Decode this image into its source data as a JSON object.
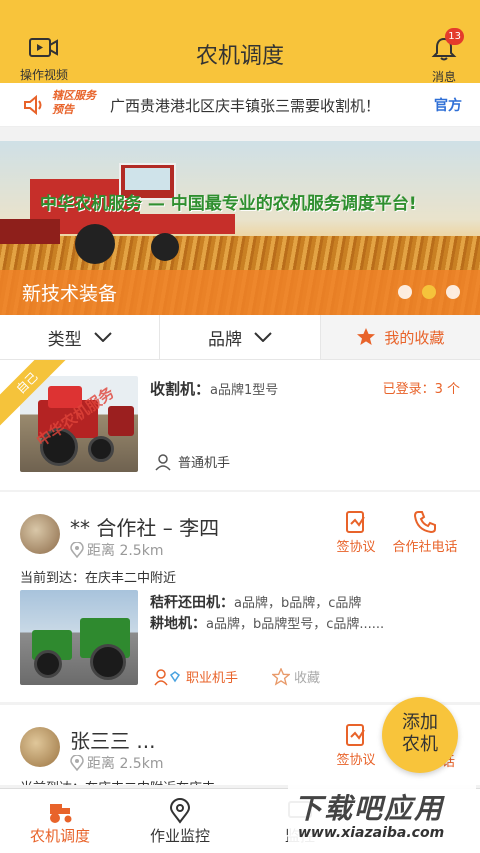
{
  "header": {
    "left_label": "操作视频",
    "title": "农机调度",
    "right_label": "消息",
    "badge_count": "13",
    "accent": "#f8c43b"
  },
  "notice": {
    "tag": "辖区服务预告",
    "text": "广西贵港港北区庆丰镇张三需要收割机！",
    "official": "官方"
  },
  "banner": {
    "slogan": "中华农机服务 — 中国最专业的农机服务调度平台!",
    "caption": "新技术装备",
    "slides": 3,
    "active_slide": 2
  },
  "filters": {
    "type_label": "类型",
    "brand_label": "品牌",
    "favorites_label": "我的收藏"
  },
  "machines": [
    {
      "ribbon": "自己",
      "image_stamp": "中华农机服务",
      "title_key": "收割机：",
      "title_value": "a品牌1型号",
      "login_status": "已登录：3 个",
      "role": "普通机手"
    },
    {
      "name": "** 合作社 – 李四",
      "distance": "距离 2.5km",
      "action1": "签协议",
      "action2": "合作社电话",
      "reach": "当前到达：在庆丰二中附近",
      "spec1_key": "秸秆还田机：",
      "spec1_value": "a品牌，b品牌，c品牌",
      "spec2_key": "耕地机：",
      "spec2_value": "a品牌，b品牌型号，c品牌......",
      "role": "职业机手",
      "favorite": "收藏"
    },
    {
      "name": "张三三 ...",
      "distance": "距离 2.5km",
      "action1": "签协议",
      "action2": "电话",
      "reach": "当前到达：在庆丰二中附近在庆丰"
    }
  ],
  "fab": {
    "line1": "添加",
    "line2": "农机"
  },
  "tabs": [
    {
      "label": "农机调度",
      "icon": "tractor-icon"
    },
    {
      "label": "作业监控",
      "icon": "location-pin-icon"
    },
    {
      "label": "监控",
      "icon": "monitor-icon"
    }
  ],
  "site_watermark": {
    "big": "下载吧应用",
    "small": "www.xiazaiba.com"
  }
}
